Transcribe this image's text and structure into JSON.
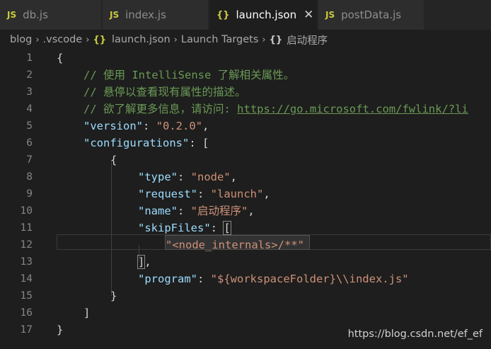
{
  "tabs": [
    {
      "icon": "JS",
      "label": "db.js",
      "active": false
    },
    {
      "icon": "JS",
      "label": "index.js",
      "active": false
    },
    {
      "icon": "{}",
      "label": "launch.json",
      "active": true,
      "close": "✕"
    },
    {
      "icon": "JS",
      "label": "postData.js",
      "active": false
    }
  ],
  "breadcrumb": {
    "items": [
      "blog",
      ".vscode",
      "launch.json",
      "Launch Targets",
      "启动程序"
    ],
    "separator": "›"
  },
  "code": {
    "lines": [
      {
        "n": "1"
      },
      {
        "n": "2"
      },
      {
        "n": "3"
      },
      {
        "n": "4"
      },
      {
        "n": "5"
      },
      {
        "n": "6"
      },
      {
        "n": "7"
      },
      {
        "n": "8"
      },
      {
        "n": "9"
      },
      {
        "n": "10"
      },
      {
        "n": "11"
      },
      {
        "n": "12"
      },
      {
        "n": "13"
      },
      {
        "n": "14"
      },
      {
        "n": "15"
      },
      {
        "n": "16"
      },
      {
        "n": "17"
      }
    ],
    "l1": "{",
    "l2": "// 使用 IntelliSense 了解相关属性。",
    "l3": "// 悬停以查看现有属性的描述。",
    "l4_prefix": "// 欲了解更多信息，请访问: ",
    "l4_link": "https://go.microsoft.com/fwlink/?li",
    "l5_key": "\"version\"",
    "l5_sep": ": ",
    "l5_val": "\"0.2.0\"",
    "l5_end": ",",
    "l6_key": "\"configurations\"",
    "l6_sep": ": ",
    "l6_open": "[",
    "l7": "{",
    "l8_key": "\"type\"",
    "l8_sep": ": ",
    "l8_val": "\"node\"",
    "l8_end": ",",
    "l9_key": "\"request\"",
    "l9_sep": ": ",
    "l9_val": "\"launch\"",
    "l9_end": ",",
    "l10_key": "\"name\"",
    "l10_sep": ": ",
    "l10_val": "\"启动程序\"",
    "l10_end": ",",
    "l11_key": "\"skipFiles\"",
    "l11_sep": ": ",
    "l11_open": "[",
    "l12_val": "\"<node_internals>/**\"",
    "l13_close": "]",
    "l13_end": ",",
    "l14_key": "\"program\"",
    "l14_sep": ": ",
    "l14_val": "\"${workspaceFolder}\\\\index.js\"",
    "l15": "}",
    "l16": "]",
    "l17": "}"
  },
  "watermark": "https://blog.csdn.net/ef_ef",
  "colors": {
    "background": "#1e1e1e",
    "comment": "#6a9955",
    "key": "#9cdcfe",
    "string": "#ce9178",
    "js_icon": "#cbcb41"
  }
}
